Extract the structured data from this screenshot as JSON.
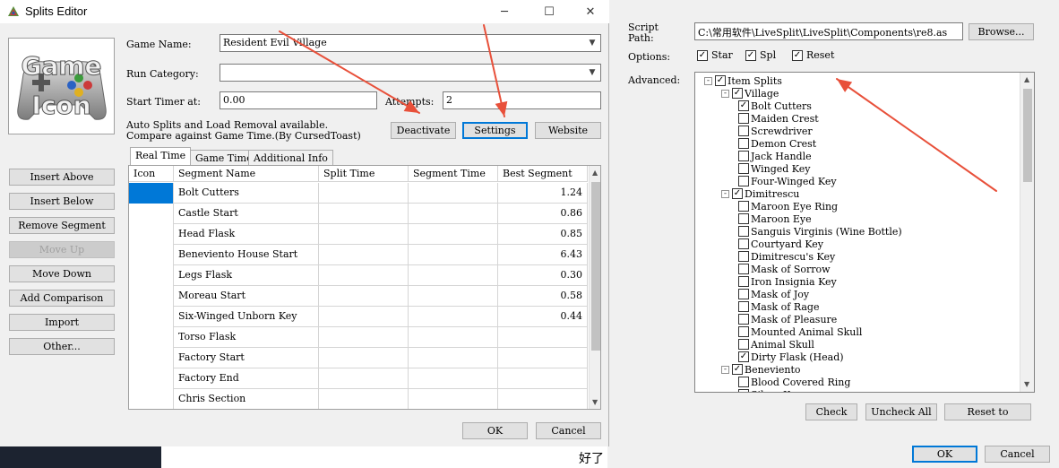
{
  "left_window": {
    "title": "Splits Editor",
    "game_icon_text_top": "Game",
    "game_icon_text_bottom": "Icon",
    "game_name_label": "Game Name:",
    "game_name_value": "Resident Evil Village",
    "run_category_label": "Run Category:",
    "run_category_value": "",
    "start_timer_label": "Start Timer at:",
    "start_timer_value": "0.00",
    "attempts_label": "Attempts:",
    "attempts_value": "2",
    "autosplit_line1": "Auto Splits and Load Removal available.",
    "autosplit_line2": "Compare against Game Time.(By CursedToast)",
    "deactivate_label": "Deactivate",
    "settings_label": "Settings",
    "website_label": "Website",
    "side_buttons": [
      "Insert Above",
      "Insert Below",
      "Remove Segment",
      "Move Up",
      "Move Down",
      "Add Comparison",
      "Import",
      "Other..."
    ],
    "tabs": [
      "Real Time",
      "Game Time",
      "Additional Info"
    ],
    "columns": [
      "Icon",
      "Segment Name",
      "Split Time",
      "Segment Time",
      "Best Segment"
    ],
    "rows": [
      {
        "name": "Bolt Cutters",
        "best": "1.24"
      },
      {
        "name": "Castle Start",
        "best": "0.86"
      },
      {
        "name": "Head Flask",
        "best": "0.85"
      },
      {
        "name": "Beneviento House Start",
        "best": "6.43"
      },
      {
        "name": "Legs Flask",
        "best": "0.30"
      },
      {
        "name": "Moreau Start",
        "best": "0.58"
      },
      {
        "name": "Six-Winged Unborn Key",
        "best": "0.44"
      },
      {
        "name": "Torso Flask",
        "best": ""
      },
      {
        "name": "Factory Start",
        "best": ""
      },
      {
        "name": "Factory End",
        "best": ""
      },
      {
        "name": "Chris Section",
        "best": ""
      }
    ],
    "ok_label": "OK",
    "cancel_label": "Cancel",
    "background_text": "好了"
  },
  "right_window": {
    "script_path_label_line1": "Script",
    "script_path_label_line2": "Path:",
    "script_path_value": "C:\\常用软件\\LiveSplit\\LiveSplit\\Components\\re8.as",
    "browse_label": "Browse...",
    "options_label": "Options:",
    "options": [
      {
        "label": "Star",
        "checked": true
      },
      {
        "label": "Spl",
        "checked": true
      },
      {
        "label": "Reset",
        "checked": true
      }
    ],
    "advanced_label": "Advanced:",
    "tree": [
      {
        "level": 0,
        "label": "Item Splits",
        "checked": true,
        "expander": "-"
      },
      {
        "level": 1,
        "label": "Village",
        "checked": true,
        "expander": "-"
      },
      {
        "level": 2,
        "label": "Bolt Cutters",
        "checked": true
      },
      {
        "level": 2,
        "label": "Maiden Crest",
        "checked": false
      },
      {
        "level": 2,
        "label": "Screwdriver",
        "checked": false
      },
      {
        "level": 2,
        "label": "Demon Crest",
        "checked": false
      },
      {
        "level": 2,
        "label": "Jack Handle",
        "checked": false
      },
      {
        "level": 2,
        "label": "Winged Key",
        "checked": false
      },
      {
        "level": 2,
        "label": "Four-Winged Key",
        "checked": false
      },
      {
        "level": 1,
        "label": "Dimitrescu",
        "checked": true,
        "expander": "-"
      },
      {
        "level": 2,
        "label": "Maroon Eye Ring",
        "checked": false
      },
      {
        "level": 2,
        "label": "Maroon Eye",
        "checked": false
      },
      {
        "level": 2,
        "label": "Sanguis Virginis (Wine Bottle)",
        "checked": false
      },
      {
        "level": 2,
        "label": "Courtyard Key",
        "checked": false
      },
      {
        "level": 2,
        "label": "Dimitrescu's Key",
        "checked": false
      },
      {
        "level": 2,
        "label": "Mask of Sorrow",
        "checked": false
      },
      {
        "level": 2,
        "label": "Iron Insignia Key",
        "checked": false
      },
      {
        "level": 2,
        "label": "Mask of Joy",
        "checked": false
      },
      {
        "level": 2,
        "label": "Mask of Rage",
        "checked": false
      },
      {
        "level": 2,
        "label": "Mask of Pleasure",
        "checked": false
      },
      {
        "level": 2,
        "label": "Mounted Animal Skull",
        "checked": false
      },
      {
        "level": 2,
        "label": "Animal Skull",
        "checked": false
      },
      {
        "level": 2,
        "label": "Dirty Flask (Head)",
        "checked": true
      },
      {
        "level": 1,
        "label": "Beneviento",
        "checked": true,
        "expander": "-"
      },
      {
        "level": 2,
        "label": "Blood Covered Ring",
        "checked": false
      },
      {
        "level": 2,
        "label": "Silver Key",
        "checked": false
      }
    ],
    "check_label": "Check",
    "uncheck_all_label": "Uncheck All",
    "reset_to_label": "Reset to",
    "ok_label": "OK",
    "cancel_label": "Cancel"
  },
  "colors": {
    "arrow": "#e8503a",
    "selection": "#0078d7",
    "window_bg": "#f0f0f0"
  }
}
